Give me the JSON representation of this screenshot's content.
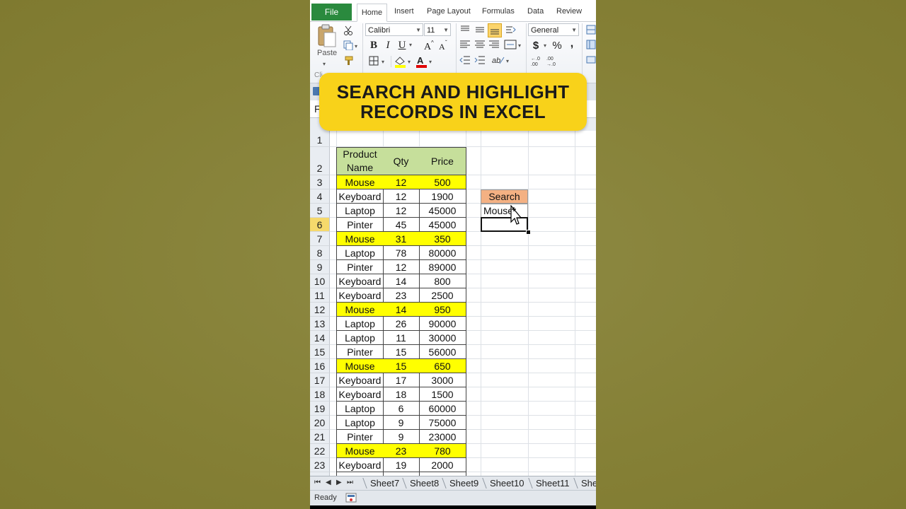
{
  "ribbon": {
    "tabs": [
      "File",
      "Home",
      "Insert",
      "Page Layout",
      "Formulas",
      "Data",
      "Review"
    ],
    "paste_label": "Paste",
    "clipboard_group_label": "Cli",
    "font_name": "Calibri",
    "font_size": "11",
    "number_format": "General",
    "bold": "B",
    "italic": "I",
    "underline": "U",
    "currency": "$",
    "percent": "%",
    "comma": ","
  },
  "banner": {
    "line1": "SEARCH AND HIGHLIGHT",
    "line2": "RECORDS IN EXCEL"
  },
  "formula_bar_fragment": "F",
  "table": {
    "headers": [
      "Product Name",
      "Qty",
      "Price"
    ],
    "rows": [
      {
        "name": "Mouse",
        "qty": "12",
        "price": "500",
        "highlight": true
      },
      {
        "name": "Keyboard",
        "qty": "12",
        "price": "1900",
        "highlight": false
      },
      {
        "name": "Laptop",
        "qty": "12",
        "price": "45000",
        "highlight": false
      },
      {
        "name": "Pinter",
        "qty": "45",
        "price": "45000",
        "highlight": false
      },
      {
        "name": "Mouse",
        "qty": "31",
        "price": "350",
        "highlight": true
      },
      {
        "name": "Laptop",
        "qty": "78",
        "price": "80000",
        "highlight": false
      },
      {
        "name": "Pinter",
        "qty": "12",
        "price": "89000",
        "highlight": false
      },
      {
        "name": "Keyboard",
        "qty": "14",
        "price": "800",
        "highlight": false
      },
      {
        "name": "Keyboard",
        "qty": "23",
        "price": "2500",
        "highlight": false
      },
      {
        "name": "Mouse",
        "qty": "14",
        "price": "950",
        "highlight": true
      },
      {
        "name": "Laptop",
        "qty": "26",
        "price": "90000",
        "highlight": false
      },
      {
        "name": "Laptop",
        "qty": "11",
        "price": "30000",
        "highlight": false
      },
      {
        "name": "Pinter",
        "qty": "15",
        "price": "56000",
        "highlight": false
      },
      {
        "name": "Mouse",
        "qty": "15",
        "price": "650",
        "highlight": true
      },
      {
        "name": "Keyboard",
        "qty": "17",
        "price": "3000",
        "highlight": false
      },
      {
        "name": "Keyboard",
        "qty": "18",
        "price": "1500",
        "highlight": false
      },
      {
        "name": "Laptop",
        "qty": "6",
        "price": "60000",
        "highlight": false
      },
      {
        "name": "Laptop",
        "qty": "9",
        "price": "75000",
        "highlight": false
      },
      {
        "name": "Pinter",
        "qty": "9",
        "price": "23000",
        "highlight": false
      },
      {
        "name": "Mouse",
        "qty": "23",
        "price": "780",
        "highlight": true
      },
      {
        "name": "Keyboard",
        "qty": "19",
        "price": "2000",
        "highlight": false
      }
    ]
  },
  "row_numbers": [
    "1",
    "2",
    "3",
    "4",
    "5",
    "6",
    "7",
    "8",
    "9",
    "10",
    "11",
    "12",
    "13",
    "14",
    "15",
    "16",
    "17",
    "18",
    "19",
    "20",
    "21",
    "22",
    "23"
  ],
  "selected_row": "6",
  "search": {
    "label": "Search",
    "value": "Mouse"
  },
  "sheet_tabs": [
    "Sheet7",
    "Sheet8",
    "Sheet9",
    "Sheet10",
    "Sheet11",
    "She"
  ],
  "status": {
    "ready": "Ready"
  },
  "colors": {
    "highlight": "#ffff00",
    "header_fill": "#c6df9b",
    "search_fill": "#f4b183",
    "file_tab": "#2a8a3e",
    "banner": "#f8d21a"
  }
}
